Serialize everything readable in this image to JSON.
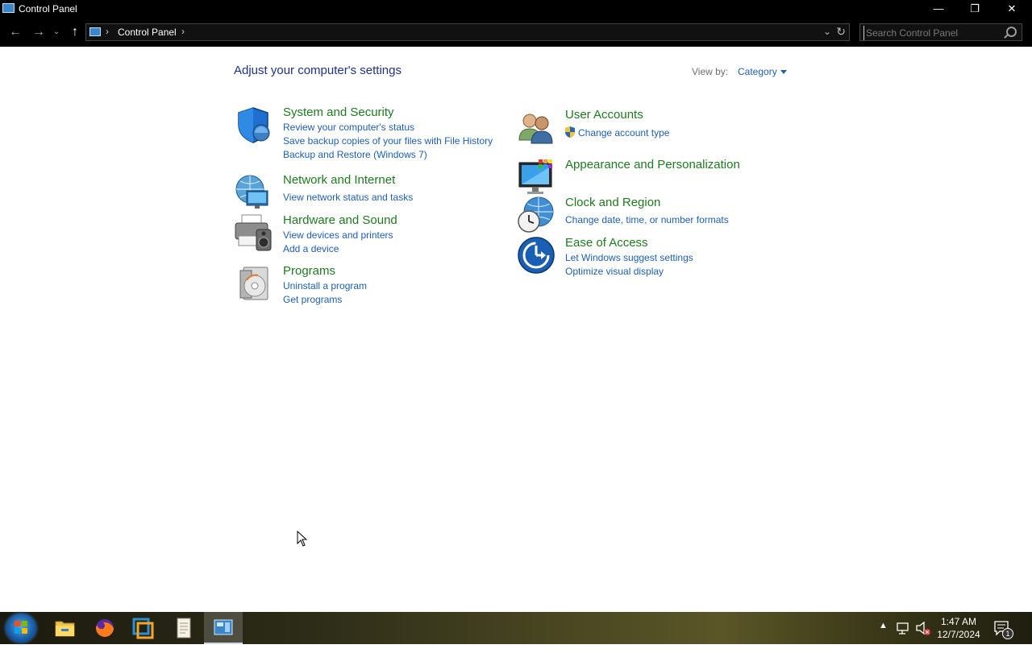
{
  "window": {
    "title": "Control Panel",
    "minimize_glyph": "—",
    "restore_glyph": "❐",
    "close_glyph": "✕"
  },
  "address": {
    "breadcrumb": [
      "Control Panel"
    ],
    "search_placeholder": "Search Control Panel"
  },
  "main": {
    "title": "Adjust your computer's settings",
    "view_by_label": "View by:",
    "view_by_value": "Category",
    "categories": [
      {
        "name": "System and Security",
        "icon": "shield-icon",
        "links": [
          "Review your computer's status",
          "Save backup copies of your files with File History",
          "Backup and Restore (Windows 7)"
        ]
      },
      {
        "name": "Network and Internet",
        "icon": "network-globe-icon",
        "links": [
          "View network status and tasks"
        ]
      },
      {
        "name": "Hardware and Sound",
        "icon": "printer-speaker-icon",
        "links": [
          "View devices and printers",
          "Add a device"
        ]
      },
      {
        "name": "Programs",
        "icon": "programs-disc-icon",
        "links": [
          "Uninstall a program",
          "Get programs"
        ]
      },
      {
        "name": "User Accounts",
        "icon": "users-icon",
        "links": [
          "Change account type"
        ]
      },
      {
        "name": "Appearance and Personalization",
        "icon": "monitor-palette-icon",
        "links": []
      },
      {
        "name": "Clock and Region",
        "icon": "clock-globe-icon",
        "links": [
          "Change date, time, or number formats"
        ]
      },
      {
        "name": "Ease of Access",
        "icon": "ease-of-access-icon",
        "links": [
          "Let Windows suggest settings",
          "Optimize visual display"
        ]
      }
    ]
  },
  "taskbar": {
    "apps": [
      "file-explorer-icon",
      "firefox-icon",
      "vmware-icon",
      "notepad-icon",
      "control-panel-icon"
    ],
    "time": "1:47 AM",
    "date": "12/7/2024",
    "notification_count": "1"
  },
  "colors": {
    "category_heading": "#1e7a1e",
    "link": "#1e5fb4",
    "page_title": "#1e3287"
  }
}
